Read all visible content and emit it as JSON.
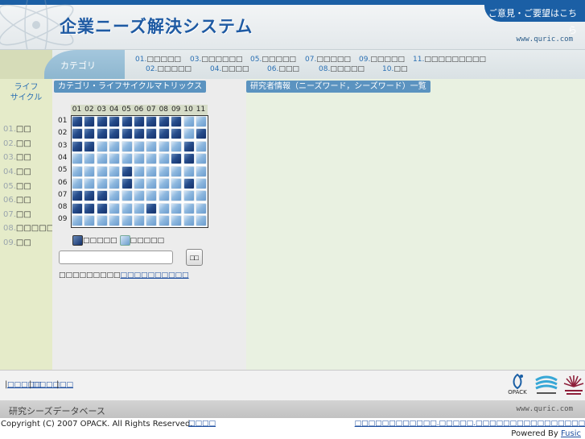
{
  "header": {
    "title": "企業ニーズ解決システム",
    "feedback_link": "ご意見・ご要望はこちら",
    "domain": "www.quric.com"
  },
  "category_bar": {
    "label": "カテゴリ",
    "items": [
      {
        "num": "01.",
        "label": "□□□□□"
      },
      {
        "num": "02.",
        "label": "□□□□□"
      },
      {
        "num": "03.",
        "label": "□□□□□□"
      },
      {
        "num": "04.",
        "label": "□□□□"
      },
      {
        "num": "05.",
        "label": "□□□□□"
      },
      {
        "num": "06.",
        "label": "□□□"
      },
      {
        "num": "07.",
        "label": "□□□□□"
      },
      {
        "num": "08.",
        "label": "□□□□□"
      },
      {
        "num": "09.",
        "label": "□□□□□"
      },
      {
        "num": "10.",
        "label": "□□"
      },
      {
        "num": "11.",
        "label": "□□□□□□□□□"
      }
    ]
  },
  "sidebar": {
    "title_line1": "ライフ",
    "title_line2": "サイクル",
    "items": [
      {
        "num": "01.",
        "label": "□□"
      },
      {
        "num": "02.",
        "label": "□□"
      },
      {
        "num": "03.",
        "label": "□□"
      },
      {
        "num": "04.",
        "label": "□□"
      },
      {
        "num": "05.",
        "label": "□□"
      },
      {
        "num": "06.",
        "label": "□□"
      },
      {
        "num": "07.",
        "label": "□□"
      },
      {
        "num": "08.",
        "label": "□□□□□"
      },
      {
        "num": "09.",
        "label": "□□"
      }
    ]
  },
  "matrix": {
    "header": "カテゴリ・ライフサイクルマトリックス",
    "columns": [
      "01",
      "02",
      "03",
      "04",
      "05",
      "06",
      "07",
      "08",
      "09",
      "10",
      "11"
    ],
    "rows": [
      {
        "label": "01",
        "cells": [
          1,
          1,
          1,
          1,
          1,
          1,
          1,
          1,
          1,
          0,
          0
        ]
      },
      {
        "label": "02",
        "cells": [
          1,
          1,
          1,
          1,
          1,
          1,
          1,
          1,
          1,
          0,
          1
        ]
      },
      {
        "label": "03",
        "cells": [
          1,
          1,
          0,
          0,
          0,
          0,
          0,
          0,
          0,
          1,
          0
        ]
      },
      {
        "label": "04",
        "cells": [
          0,
          0,
          0,
          0,
          0,
          0,
          0,
          0,
          1,
          1,
          0
        ]
      },
      {
        "label": "05",
        "cells": [
          0,
          0,
          0,
          0,
          1,
          0,
          0,
          0,
          0,
          0,
          0
        ]
      },
      {
        "label": "06",
        "cells": [
          0,
          0,
          0,
          0,
          1,
          0,
          0,
          0,
          0,
          1,
          0
        ]
      },
      {
        "label": "07",
        "cells": [
          1,
          1,
          1,
          0,
          0,
          0,
          0,
          0,
          0,
          0,
          0
        ]
      },
      {
        "label": "08",
        "cells": [
          1,
          1,
          1,
          0,
          0,
          0,
          1,
          0,
          0,
          0,
          0
        ]
      },
      {
        "label": "09",
        "cells": [
          0,
          0,
          0,
          0,
          0,
          0,
          0,
          0,
          0,
          0,
          0
        ]
      }
    ],
    "legend_dark": "□□□□□",
    "legend_light": "□□□□□",
    "search_value": "",
    "search_button": "□□",
    "help_text": "□□□□□□□□□",
    "help_link": "□□□□□□□□□□"
  },
  "researchers": {
    "header": "研究者情報（ニーズワード，シーズワード）一覧"
  },
  "footer": {
    "link1": "□□□□□",
    "link2": "□□□□□□",
    "logo_opack": "OPACK",
    "db_title": "研究シーズデータベース",
    "db_domain": "www.quric.com",
    "copyright": "Copyright (C) 2007 OPACK. All Rights Reserved.",
    "copyright_link": "□□□□",
    "right_link": "□□□□□□□□□□□□.□□□□□.□□□□□□□□□□□□□□□□",
    "powered_by": "Powered By",
    "powered_link": "Fusic"
  },
  "colors": {
    "brand_blue": "#1b5fa5",
    "panel_header": "#5b93c0",
    "sidebar_bg": "#e5ebc9",
    "researchers_bg": "#e9f1e1"
  }
}
